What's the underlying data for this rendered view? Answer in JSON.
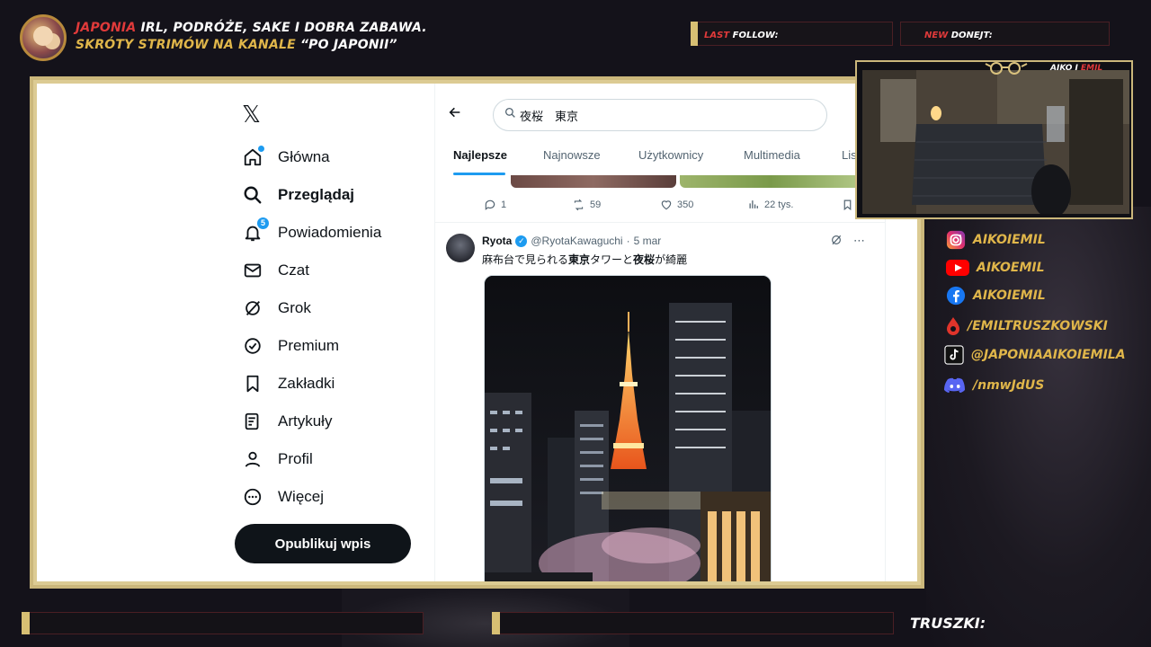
{
  "header": {
    "line1_red": "JAPONIA",
    "line1_rest": " IRL, PODRÓŻE, SAKE I DOBRA ZABAWA.",
    "line2_gold": "SKRÓTY STRIMÓW NA KANALE ",
    "line2_white": "“PO JAPONII”"
  },
  "alerts": {
    "last_follow_red": "LAST",
    "last_follow_white": " FOLLOW:",
    "new_donate_red": "NEW",
    "new_donate_white": " DONEJT:"
  },
  "x_app": {
    "nav": [
      {
        "label": "Główna",
        "icon": "home-icon"
      },
      {
        "label": "Przeglądaj",
        "icon": "search-icon"
      },
      {
        "label": "Powiadomienia",
        "icon": "bell-icon",
        "badge": "5"
      },
      {
        "label": "Czat",
        "icon": "mail-icon"
      },
      {
        "label": "Grok",
        "icon": "grok-icon"
      },
      {
        "label": "Premium",
        "icon": "premium-icon"
      },
      {
        "label": "Zakładki",
        "icon": "bookmark-icon"
      },
      {
        "label": "Artykuły",
        "icon": "article-icon"
      },
      {
        "label": "Profil",
        "icon": "profile-icon"
      },
      {
        "label": "Więcej",
        "icon": "more-icon"
      }
    ],
    "post_button": "Opublikuj wpis",
    "search_value": "夜桜　東京",
    "tabs": [
      "Najlepsze",
      "Najnowsze",
      "Użytkownicy",
      "Multimedia",
      "Lis"
    ],
    "prev_tweet_stats": {
      "replies": "1",
      "reposts": "59",
      "likes": "350",
      "views": "22 tys."
    },
    "tweet": {
      "name": "Ryota",
      "handle": "@RyotaKawaguchi",
      "separator": " · ",
      "date": "5 mar",
      "text_parts": [
        "麻布台で見られる",
        "東京",
        "タワーと",
        "夜桜",
        "が綺麗"
      ]
    }
  },
  "webcam": {
    "label_white": "AIKO I ",
    "label_red": "EMIL"
  },
  "socials": [
    {
      "icon": "instagram-icon",
      "text": "AIKOIEMIL",
      "color": "#e1306c"
    },
    {
      "icon": "youtube-icon",
      "text": "AIKOEMIL",
      "color": "#ff0000"
    },
    {
      "icon": "facebook-icon",
      "text": "AIKOIEMIL",
      "color": "#1877f2"
    },
    {
      "icon": "patronite-icon",
      "text": "/EMILTRUSZKOWSKI",
      "color": "#e0342b"
    },
    {
      "icon": "tiktok-icon",
      "text": "@JAPONIAAIKOIEMILA",
      "color": "#ffffff"
    },
    {
      "icon": "discord-icon",
      "text": "/nmwJdUS",
      "color": "#5865f2"
    }
  ],
  "bottom": {
    "truszki_label": "TRUSZKI:"
  },
  "colors": {
    "accent_gold": "#e0b64a",
    "accent_red": "#e03a3a",
    "frame_gold": "#cbb77b",
    "x_blue": "#1d9bf0"
  }
}
